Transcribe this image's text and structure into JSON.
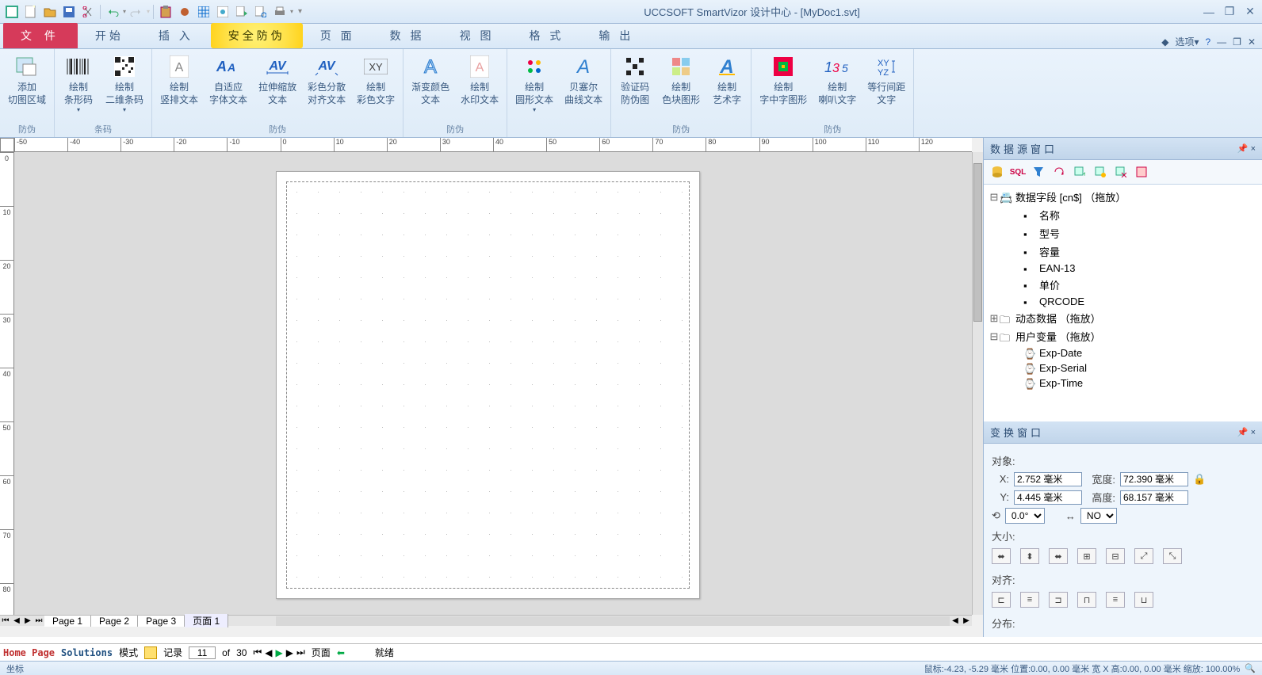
{
  "app_title": "UCCSOFT SmartVizor 设计中心 - [MyDoc1.svt]",
  "tabs": {
    "file": "文 件",
    "start": "开始",
    "insert": "插 入",
    "security": "安全防伪",
    "page": "页 面",
    "data": "数 据",
    "view": "视 图",
    "format": "格 式",
    "output": "输 出"
  },
  "tabrow_right": "选项▾",
  "ribbon": {
    "g1": {
      "title": "防伪",
      "btn1": "添加\n切图区域"
    },
    "g2": {
      "title": "条码",
      "btn1": "绘制\n条形码",
      "btn2": "绘制\n二维条码"
    },
    "g3": {
      "title": "防伪",
      "btn1": "绘制\n竖排文本",
      "btn2": "自适应\n字体文本",
      "btn3": "拉伸缩放\n文本",
      "btn4": "彩色分散\n对齐文本",
      "btn5": "绘制\n彩色文字"
    },
    "g4": {
      "title": "防伪",
      "btn1": "渐变颜色\n文本",
      "btn2": "绘制\n水印文本"
    },
    "g5": {
      "title": "",
      "btn1": "绘制\n圆形文本",
      "btn2": "贝塞尔\n曲线文本"
    },
    "g6": {
      "title": "防伪",
      "btn1": "验证码\n防伪图",
      "btn2": "绘制\n色块图形",
      "btn3": "绘制\n艺术字"
    },
    "g7": {
      "title": "防伪",
      "btn1": "绘制\n字中字图形",
      "btn2": "绘制\n喇叭文字",
      "btn3": "等行间距\n文字"
    }
  },
  "hruler": [
    "-50",
    "-40",
    "-30",
    "-20",
    "-10",
    "0",
    "10",
    "20",
    "30",
    "40",
    "50",
    "60",
    "70",
    "80",
    "90",
    "100",
    "110",
    "120"
  ],
  "vruler": [
    "0",
    "10",
    "20",
    "30",
    "40",
    "50",
    "60",
    "70",
    "80"
  ],
  "pagetabs": [
    "Page  1",
    "Page  2",
    "Page  3"
  ],
  "pagetab_current": "页面  1",
  "datasource": {
    "title": "数据源窗口",
    "root": "数据字段 [cn$] （拖放）",
    "fields": [
      "名称",
      "型号",
      "容量",
      "EAN-13",
      "单价",
      "QRCODE"
    ],
    "dyn": "动态数据 （拖放）",
    "userv": "用户变量 （拖放）",
    "uvars": [
      "Exp-Date",
      "Exp-Serial",
      "Exp-Time"
    ]
  },
  "transform": {
    "title": "变换窗口",
    "obj_lbl": "对象:",
    "x_lbl": "X:",
    "x_val": "2.752 毫米",
    "y_lbl": "Y:",
    "y_val": "4.445 毫米",
    "w_lbl": "宽度:",
    "w_val": "72.390 毫米",
    "h_lbl": "高度:",
    "h_val": "68.157 毫米",
    "rot_val": "0.0°",
    "flip_val": "NO",
    "size_lbl": "大小:",
    "align_lbl": "对齐:",
    "dist_lbl": "分布:"
  },
  "status1": {
    "home": "Home Page",
    "sol": "Solutions",
    "mode": "模式",
    "rec": "记录",
    "rec_cur": "11",
    "rec_of": "of",
    "rec_total": "30",
    "page": "页面",
    "ready": "就绪"
  },
  "status2": {
    "left": "坐标",
    "right": "鼠标:-4.23, -5.29 毫米 位置:0.00, 0.00 毫米 宽 X 高:0.00, 0.00 毫米 缩放: 100.00%"
  }
}
